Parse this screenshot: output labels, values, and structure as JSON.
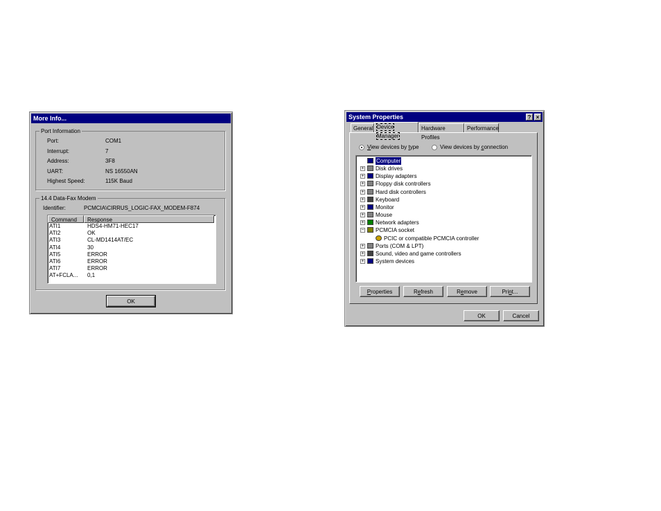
{
  "more_info": {
    "title": "More Info...",
    "port_group": "Port Information",
    "port_rows": [
      {
        "label": "Port:",
        "value": "COM1"
      },
      {
        "label": "Interrupt:",
        "value": "7"
      },
      {
        "label": "Address:",
        "value": "3F8"
      },
      {
        "label": "UART:",
        "value": "NS 16550AN"
      },
      {
        "label": "Highest Speed:",
        "value": "115K Baud"
      }
    ],
    "modem_group": "14.4 Data-Fax Modem",
    "identifier_label": "Identifier:",
    "identifier_value": "PCMCIA\\CIRRUS_LOGIC-FAX_MODEM-F874",
    "table_headers": [
      "Command",
      "Response"
    ],
    "table_rows": [
      [
        "ATI1",
        "HDS4-HM71-HEC17"
      ],
      [
        "ATI2",
        "OK"
      ],
      [
        "ATI3",
        "CL-MD1414AT/EC"
      ],
      [
        "ATI4",
        "30"
      ],
      [
        "ATI5",
        "ERROR"
      ],
      [
        "ATI6",
        "ERROR"
      ],
      [
        "ATI7",
        "ERROR"
      ],
      [
        "AT+FCLA...",
        "0,1"
      ]
    ],
    "ok_label": "OK"
  },
  "system_properties": {
    "title": "System Properties",
    "help_glyph": "?",
    "close_glyph": "×",
    "tabs": [
      "General",
      "Device Manager",
      "Hardware Profiles",
      "Performance"
    ],
    "radio_type": "View devices by type",
    "radio_connection": "View devices by connection",
    "tree": [
      {
        "label": "Computer",
        "expander": "",
        "icon": "computer-icon",
        "color": "#000080",
        "selected": true
      },
      {
        "label": "Disk drives",
        "expander": "+",
        "icon": "disk-drive-icon",
        "color": "#808080"
      },
      {
        "label": "Display adapters",
        "expander": "+",
        "icon": "display-adapter-icon",
        "color": "#000080"
      },
      {
        "label": "Floppy disk controllers",
        "expander": "+",
        "icon": "floppy-controller-icon",
        "color": "#808080"
      },
      {
        "label": "Hard disk controllers",
        "expander": "+",
        "icon": "hard-disk-controller-icon",
        "color": "#808080"
      },
      {
        "label": "Keyboard",
        "expander": "+",
        "icon": "keyboard-icon",
        "color": "#404040"
      },
      {
        "label": "Monitor",
        "expander": "+",
        "icon": "monitor-icon",
        "color": "#000080"
      },
      {
        "label": "Mouse",
        "expander": "+",
        "icon": "mouse-icon",
        "color": "#808080"
      },
      {
        "label": "Network adapters",
        "expander": "+",
        "icon": "network-adapter-icon",
        "color": "#008000"
      },
      {
        "label": "PCMCIA socket",
        "expander": "−",
        "icon": "pcmcia-socket-icon",
        "color": "#808000"
      },
      {
        "label": "PCIC or compatible PCMCIA controller",
        "expander": "",
        "icon": "pcmcia-controller-icon",
        "color": "#c8a000",
        "child": true
      },
      {
        "label": "Ports (COM & LPT)",
        "expander": "+",
        "icon": "ports-icon",
        "color": "#808080"
      },
      {
        "label": "Sound, video and game controllers",
        "expander": "+",
        "icon": "sound-icon",
        "color": "#404040"
      },
      {
        "label": "System devices",
        "expander": "+",
        "icon": "system-devices-icon",
        "color": "#000080"
      }
    ],
    "buttons": [
      "Properties",
      "Refresh",
      "Remove",
      "Print..."
    ],
    "ok_label": "OK",
    "cancel_label": "Cancel"
  }
}
